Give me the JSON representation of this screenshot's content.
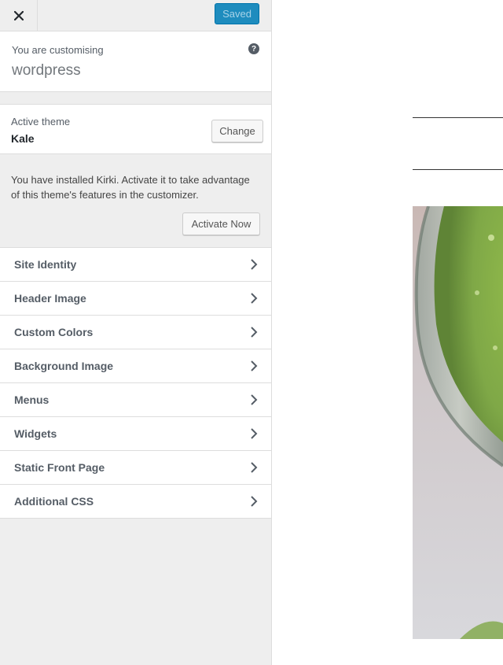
{
  "topbar": {
    "close_glyph": "✕",
    "saved_label": "Saved"
  },
  "customising": {
    "label": "You are customising",
    "site_name": "wordpress",
    "help_glyph": "?"
  },
  "theme": {
    "label": "Active theme",
    "name": "Kale",
    "change_label": "Change"
  },
  "notice": {
    "text": "You have installed Kirki. Activate it to take advantage of this theme's features in the customizer.",
    "activate_label": "Activate Now"
  },
  "sections": [
    {
      "label": "Site Identity"
    },
    {
      "label": "Header Image"
    },
    {
      "label": "Custom Colors"
    },
    {
      "label": "Background Image"
    },
    {
      "label": "Menus"
    },
    {
      "label": "Widgets"
    },
    {
      "label": "Static Front Page"
    },
    {
      "label": "Additional CSS"
    }
  ],
  "colors": {
    "accent": "#1e8cbe",
    "sidebar_bg": "#eeeeee"
  },
  "icons": [
    "close-icon",
    "help-icon",
    "chevron-right-icon"
  ]
}
